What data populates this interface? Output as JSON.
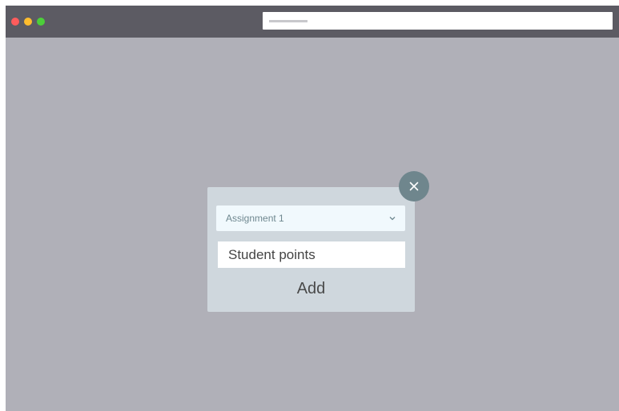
{
  "browser": {
    "window_controls": [
      "close",
      "minimize",
      "maximize"
    ],
    "address_bar": {
      "value": ""
    }
  },
  "dialog": {
    "close_icon": "close-icon",
    "assignment_select": {
      "selected": "Assignment 1",
      "icon": "chevron-down-icon"
    },
    "points_input": {
      "value": "",
      "placeholder": "Student points"
    },
    "add_label": "Add"
  },
  "colors": {
    "overlay": "#b0b0b8",
    "titlebar": "#5c5b63",
    "dialog_bg": "#cfd7dd",
    "close_button": "#6f868d",
    "select_bg": "#f1f9fd"
  }
}
